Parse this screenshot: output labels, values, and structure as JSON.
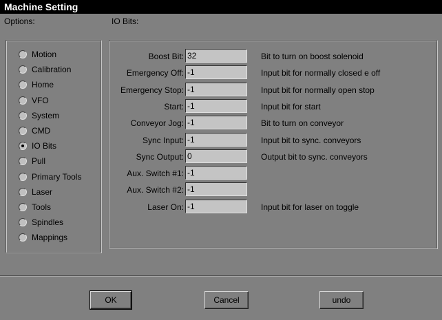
{
  "window": {
    "title": "Machine Setting"
  },
  "options": {
    "label": "Options:",
    "items": [
      {
        "label": "Motion",
        "checked": false
      },
      {
        "label": "Calibration",
        "checked": false
      },
      {
        "label": "Home",
        "checked": false
      },
      {
        "label": "VFO",
        "checked": false
      },
      {
        "label": "System",
        "checked": false
      },
      {
        "label": "CMD",
        "checked": false
      },
      {
        "label": "IO Bits",
        "checked": true
      },
      {
        "label": "Pull",
        "checked": false
      },
      {
        "label": "Primary Tools",
        "checked": false
      },
      {
        "label": "Laser",
        "checked": false
      },
      {
        "label": "Tools",
        "checked": false
      },
      {
        "label": "Spindles",
        "checked": false
      },
      {
        "label": "Mappings",
        "checked": false
      }
    ]
  },
  "io": {
    "label": "IO Bits:",
    "rows": [
      {
        "label": "Boost Bit:",
        "value": "32",
        "desc": "Bit to turn on boost solenoid"
      },
      {
        "label": "Emergency Off:",
        "value": "-1",
        "desc": "Input bit for normally closed e off"
      },
      {
        "label": "Emergency Stop:",
        "value": "-1",
        "desc": "Input bit for normally open stop"
      },
      {
        "label": "Start:",
        "value": "-1",
        "desc": "Input bit for start"
      },
      {
        "label": "Conveyor Jog:",
        "value": "-1",
        "desc": "Bit to turn on conveyor"
      },
      {
        "label": "Sync Input:",
        "value": "-1",
        "desc": "Input bit to sync. conveyors"
      },
      {
        "label": "Sync Output:",
        "value": "0",
        "desc": "Output bit to sync. conveyors"
      },
      {
        "label": "Aux. Switch #1:",
        "value": "-1",
        "desc": ""
      },
      {
        "label": "Aux. Switch #2:",
        "value": "-1",
        "desc": ""
      },
      {
        "label": "Laser On:",
        "value": "-1",
        "desc": "Input bit for laser on toggle"
      }
    ]
  },
  "buttons": {
    "ok": "OK",
    "cancel": "Cancel",
    "undo": "undo"
  }
}
